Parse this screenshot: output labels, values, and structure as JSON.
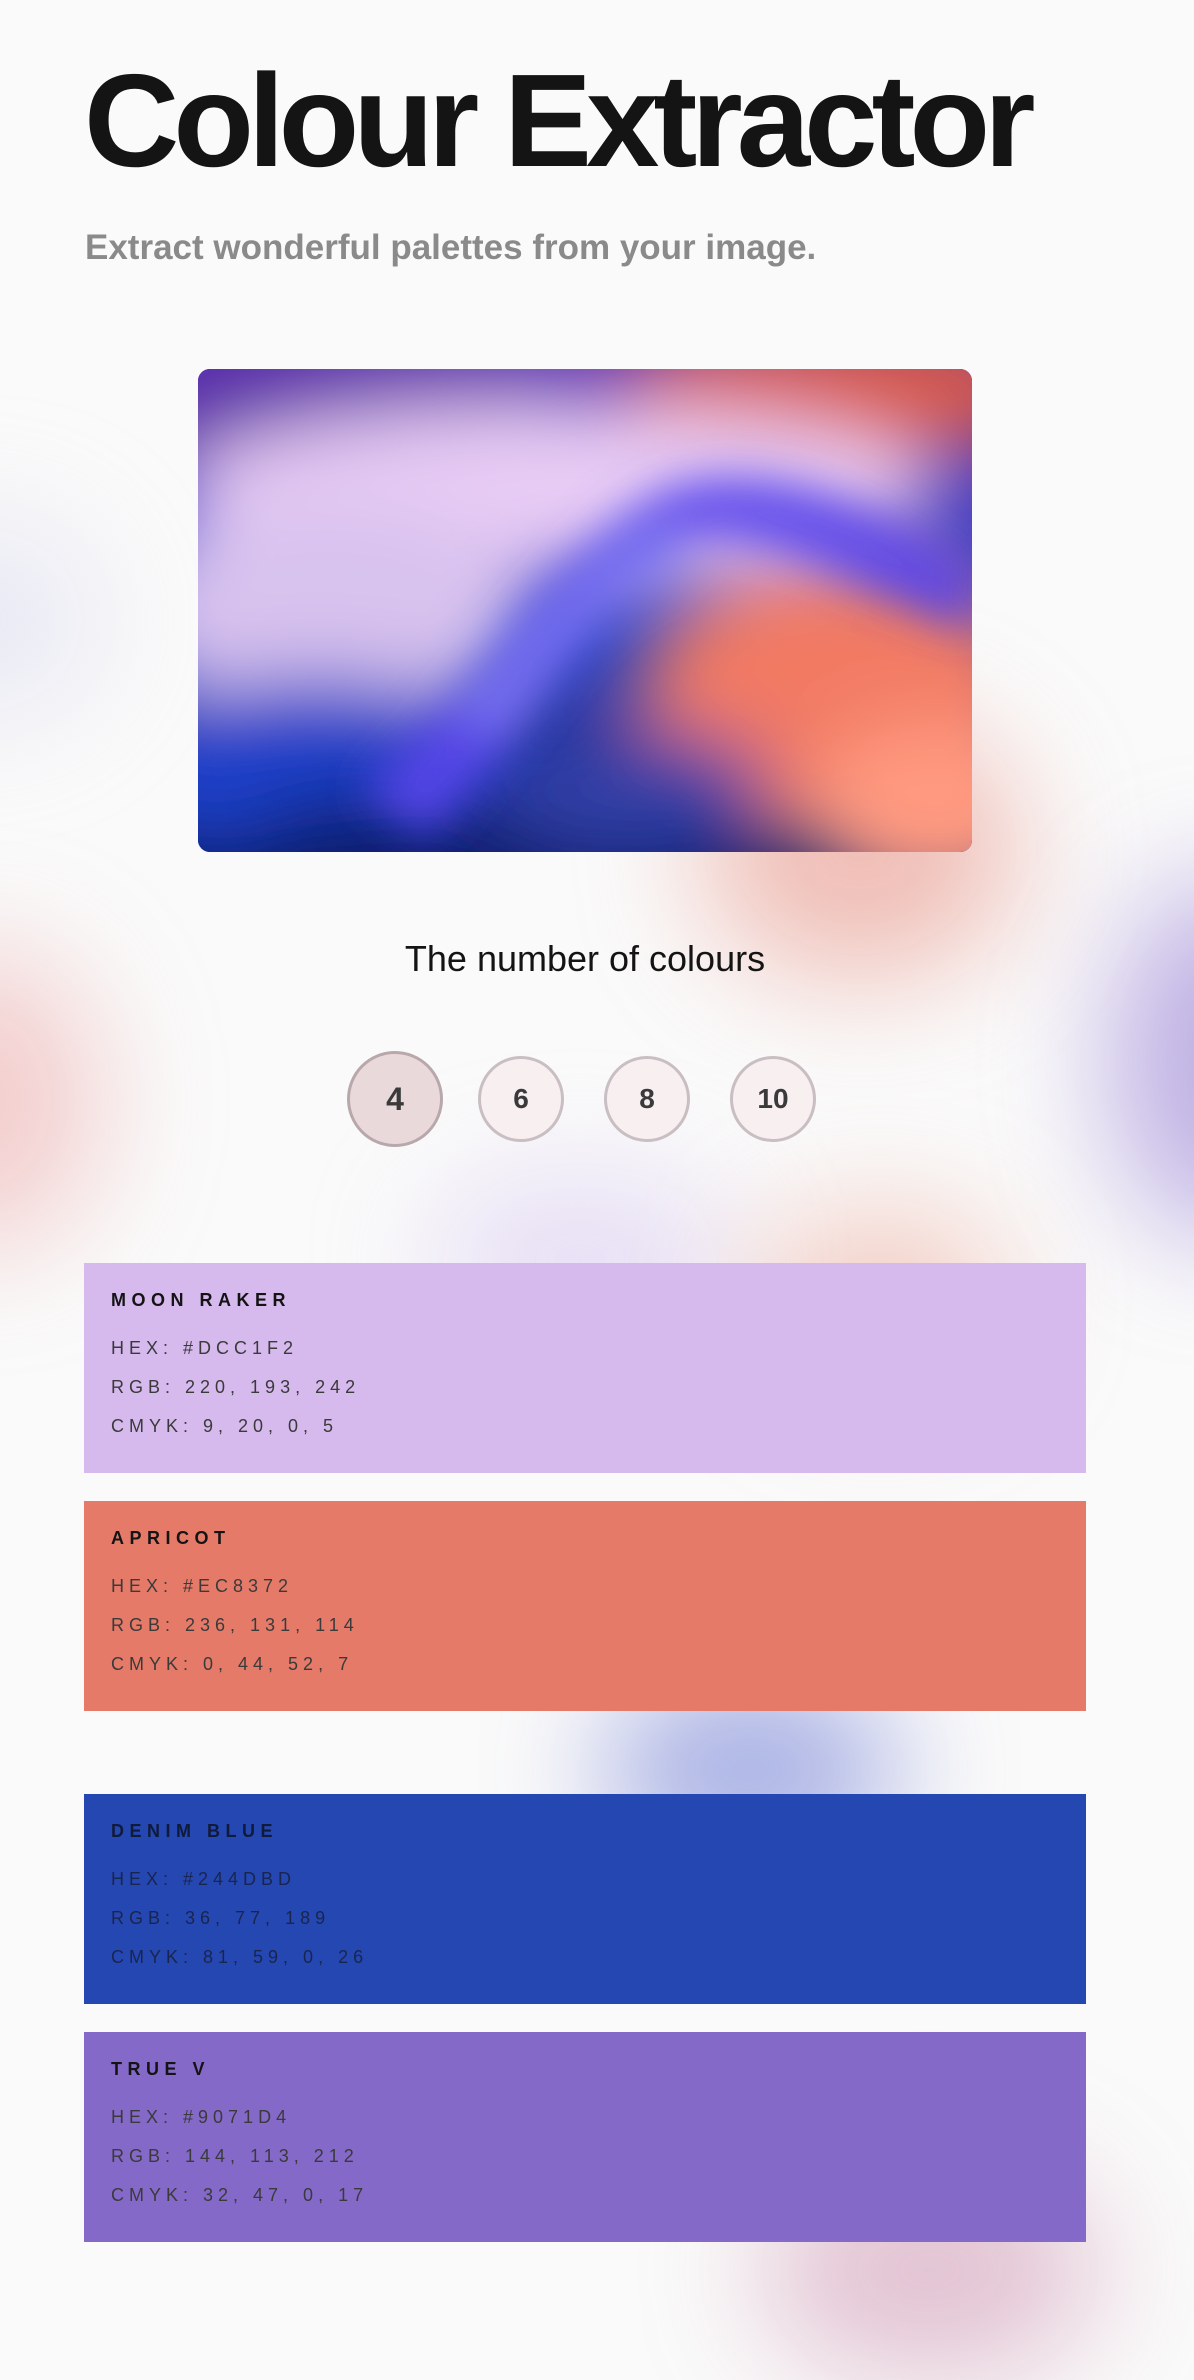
{
  "header": {
    "title": "Colour Extractor",
    "subtitle": "Extract wonderful palettes from your image."
  },
  "count_selector": {
    "label": "The number of colours",
    "options": [
      "4",
      "6",
      "8",
      "10"
    ],
    "selected": "4"
  },
  "palette": [
    {
      "name": "MOON RAKER",
      "hex": "HEX: #DCC1F2",
      "rgb": "RGB: 220, 193, 242",
      "cmyk": "CMYK: 9, 20, 0, 5",
      "color": "#d6b9ed"
    },
    {
      "name": "APRICOT",
      "hex": "HEX: #EC8372",
      "rgb": "RGB: 236, 131, 114",
      "cmyk": "CMYK: 0, 44, 52, 7",
      "color": "#e57a69"
    },
    {
      "name": "DENIM BLUE",
      "hex": "HEX: #244DBD",
      "rgb": "RGB: 36, 77, 189",
      "cmyk": "CMYK: 81, 59, 0, 26",
      "color": "#2447b1"
    },
    {
      "name": "TRUE V",
      "hex": "HEX: #9071D4",
      "rgb": "RGB: 144, 113, 212",
      "cmyk": "CMYK: 32, 47, 0, 17",
      "color": "#8569c9"
    }
  ],
  "colors": {
    "page_background": "#fafafa",
    "title": "#141414",
    "subtitle": "#8a8a8a",
    "count_button_bg": "#f8eff1",
    "count_button_active_bg": "#ead9da",
    "count_button_border": "#c9bec1"
  },
  "icons": {}
}
